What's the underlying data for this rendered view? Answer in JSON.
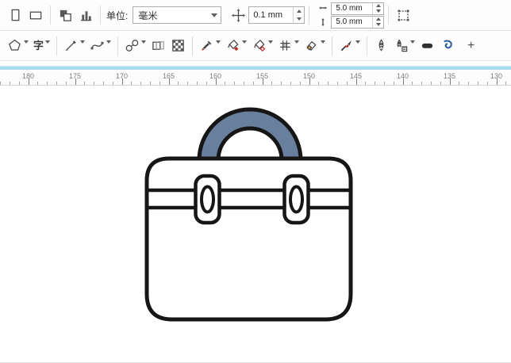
{
  "colors": {
    "handle": "#68809e",
    "outline": "#161616",
    "accent_red": "#c7271f",
    "accent_blue": "#2b5fa8",
    "scrollbar_track": "#aadcf0"
  },
  "property_bar": {
    "unit_label": "单位:",
    "unit_value": "毫米",
    "nudge_value": "0.1 mm",
    "duplicate_x_value": "5.0 mm",
    "duplicate_y_value": "5.0 mm"
  },
  "toolbox": {
    "text_tool_glyph": "字",
    "more_label": "+"
  },
  "ruler": {
    "labels": [
      "180",
      "175",
      "170",
      "165",
      "160",
      "155",
      "150",
      "145",
      "140",
      "135",
      "130"
    ]
  }
}
